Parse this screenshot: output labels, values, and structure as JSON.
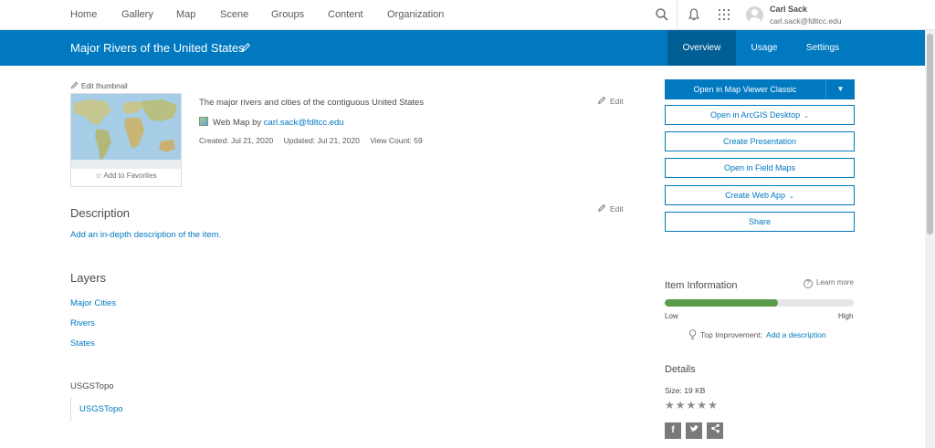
{
  "nav": {
    "items": [
      "Home",
      "Gallery",
      "Map",
      "Scene",
      "Groups",
      "Content",
      "Organization"
    ],
    "user_name": "Carl Sack",
    "user_email": "carl.sack@fdltcc.edu"
  },
  "titlebar": {
    "title": "Major Rivers of the United States",
    "tabs": [
      "Overview",
      "Usage",
      "Settings"
    ],
    "active_tab": "Overview"
  },
  "item": {
    "edit_thumbnail": "Edit thumbnail",
    "add_favorites": "Add to Favorites",
    "summary": "The major rivers and cities of the contiguous United States",
    "type_label": "Web Map by",
    "owner": "carl.sack@fdltcc.edu",
    "created": "Created: Jul 21, 2020",
    "updated": "Updated: Jul 21, 2020",
    "views": "View Count: 59",
    "edit": "Edit"
  },
  "description": {
    "title": "Description",
    "link": "Add an in-depth description of the item.",
    "edit": "Edit"
  },
  "layers": {
    "title": "Layers",
    "items": [
      "Major Cities",
      "Rivers",
      "States"
    ],
    "basemap_label": "USGSTopo",
    "basemap_link": "USGSTopo"
  },
  "actions": {
    "primary": "Open in Map Viewer Classic",
    "arcgis_desktop": "Open in ArcGIS Desktop",
    "create_presentation": "Create Presentation",
    "field_maps": "Open in Field Maps",
    "create_web_app": "Create Web App",
    "share": "Share"
  },
  "item_info": {
    "title": "Item Information",
    "learn_more": "Learn more",
    "quality_fraction": 0.6,
    "low": "Low",
    "high": "High",
    "top_improvement": "Top Improvement:",
    "improvement_link": "Add a description"
  },
  "details": {
    "title": "Details",
    "size": "Size: 19 KB",
    "rating_stars": 5,
    "share_icons": [
      "facebook-icon",
      "twitter-icon",
      "share-icon"
    ]
  },
  "colors": {
    "brand": "#0079c1",
    "brand_dark": "#005e95",
    "quality": "#5a9a4a"
  }
}
